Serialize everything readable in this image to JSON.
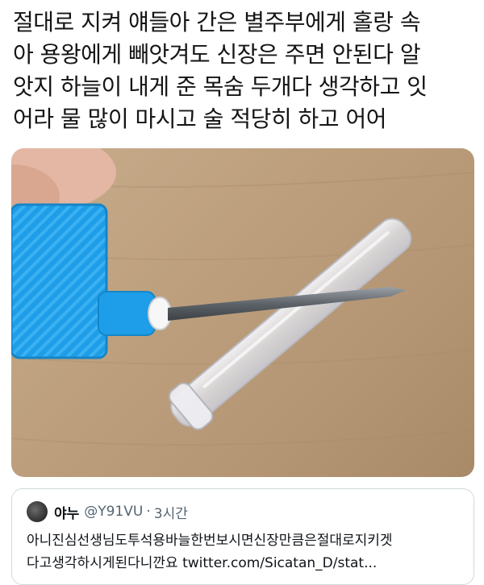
{
  "post": {
    "lines": [
      "절대로 지켜 얘들아 간은 별주부에게 홀랑 속",
      "아 용왕에게 빼앗겨도 신장은 주면 안된다 알",
      "앗지 하늘이 내게 준 목숨 두개다 생각하고 잇",
      "어라 물 많이 마시고 술 적당히 하고 어어"
    ]
  },
  "quote": {
    "name": "야누",
    "handle": "@Y91VU",
    "separator": "·",
    "time": "3시간",
    "lines": [
      "아니진심선생님도투석용바늘한번보시면신장만큼은절대로지키겟",
      "다고생각하시게된다니깐요 twitter.com/Sicatan_D/stat..."
    ]
  },
  "colors": {
    "text": "#141414",
    "muted": "#536471",
    "border": "#cfd9de",
    "syringe_blue": "#1e9ee8"
  }
}
